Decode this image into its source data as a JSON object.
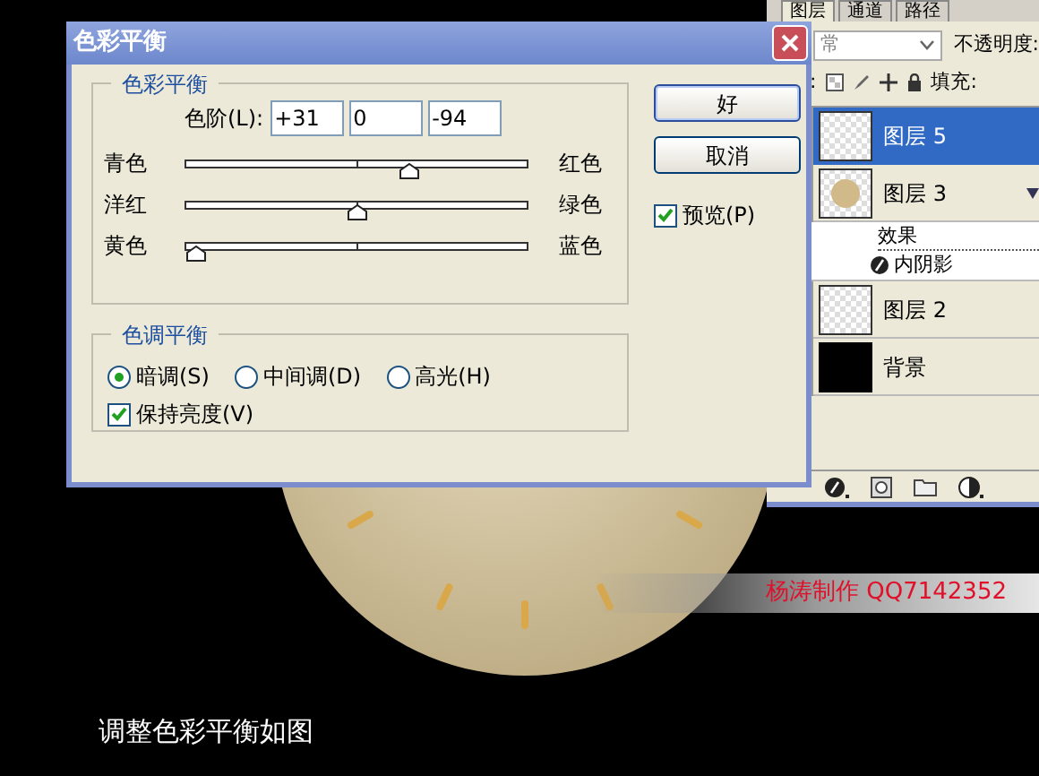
{
  "dialog": {
    "title": "色彩平衡",
    "color_balance": {
      "heading": "色彩平衡",
      "levels_label": "色阶(L):",
      "values": [
        "+31",
        "0",
        "-94"
      ],
      "sliders": [
        {
          "left": "青色",
          "right": "红色",
          "level": 0.655
        },
        {
          "left": "洋红",
          "right": "绿色",
          "level": 0.5
        },
        {
          "left": "黄色",
          "right": "蓝色",
          "level": 0.03
        }
      ]
    },
    "tone_balance": {
      "heading": "色调平衡",
      "options": [
        {
          "label": "暗调(S)",
          "selected": true
        },
        {
          "label": "中间调(D)",
          "selected": false
        },
        {
          "label": "高光(H)",
          "selected": false
        }
      ],
      "preserve_luminosity": {
        "label": "保持亮度(V)",
        "checked": true
      }
    },
    "buttons": [
      "好",
      "取消"
    ],
    "preview": {
      "label": "预览(P)",
      "checked": true
    }
  },
  "layers_panel": {
    "tabs": [
      {
        "label": "图层",
        "selected": true
      },
      {
        "label": "通道",
        "selected": false
      },
      {
        "label": "路径",
        "selected": false
      }
    ],
    "blend_mode": "常",
    "opacity_label": "不透明度:",
    "lock_label": ":",
    "fill_label": "填充:",
    "layers": [
      {
        "name": "图层 5",
        "selected": true,
        "kind": "checker"
      },
      {
        "name": "图层 3",
        "selected": false,
        "kind": "blob",
        "effects_label": "效果",
        "effects": [
          "内阴影"
        ]
      },
      {
        "name": "图层 2",
        "selected": false,
        "kind": "checker"
      },
      {
        "name": "背景",
        "selected": false,
        "kind": "solid"
      }
    ]
  },
  "credit": "杨涛制作 QQ7142352",
  "caption": "调整色彩平衡如图"
}
